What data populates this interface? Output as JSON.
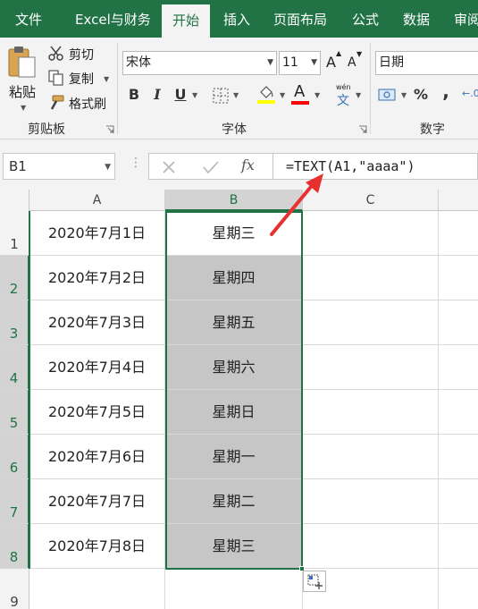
{
  "tabs": [
    "文件",
    "Excel与财务",
    "开始",
    "插入",
    "页面布局",
    "公式",
    "数据",
    "审阅"
  ],
  "active_tab": "开始",
  "clipboard": {
    "paste_label": "粘贴",
    "cut_label": "剪切",
    "copy_label": "复制",
    "format_painter_label": "格式刷",
    "group_label": "剪贴板"
  },
  "font": {
    "font_name": "宋体",
    "font_size": "11",
    "bold": "B",
    "italic": "I",
    "underline": "U",
    "font_color_glyph": "A",
    "phonetic_glyph": "文",
    "phonetic_small": "wén",
    "increase_glyph": "A",
    "decrease_glyph": "A",
    "group_label": "字体",
    "highlight_color": "#ffff00",
    "font_color": "#ff0000"
  },
  "number": {
    "format": "日期",
    "percent": "%",
    "comma": ",",
    "group_label": "数字"
  },
  "formula_bar": {
    "name_box": "B1",
    "fx_label": "fx",
    "formula": "=TEXT(A1,\"aaaa\")"
  },
  "columns": [
    "A",
    "B",
    "C"
  ],
  "rows": [
    {
      "num": "1",
      "a": "2020年7月1日",
      "b": "星期三"
    },
    {
      "num": "2",
      "a": "2020年7月2日",
      "b": "星期四"
    },
    {
      "num": "3",
      "a": "2020年7月3日",
      "b": "星期五"
    },
    {
      "num": "4",
      "a": "2020年7月4日",
      "b": "星期六"
    },
    {
      "num": "5",
      "a": "2020年7月5日",
      "b": "星期日"
    },
    {
      "num": "6",
      "a": "2020年7月6日",
      "b": "星期一"
    },
    {
      "num": "7",
      "a": "2020年7月7日",
      "b": "星期二"
    },
    {
      "num": "8",
      "a": "2020年7月8日",
      "b": "星期三"
    },
    {
      "num": "9",
      "a": "",
      "b": ""
    }
  ],
  "colors": {
    "excel_green": "#217346",
    "annotation_arrow": "#e8312f",
    "selection_fill": "#c6c6c6"
  }
}
